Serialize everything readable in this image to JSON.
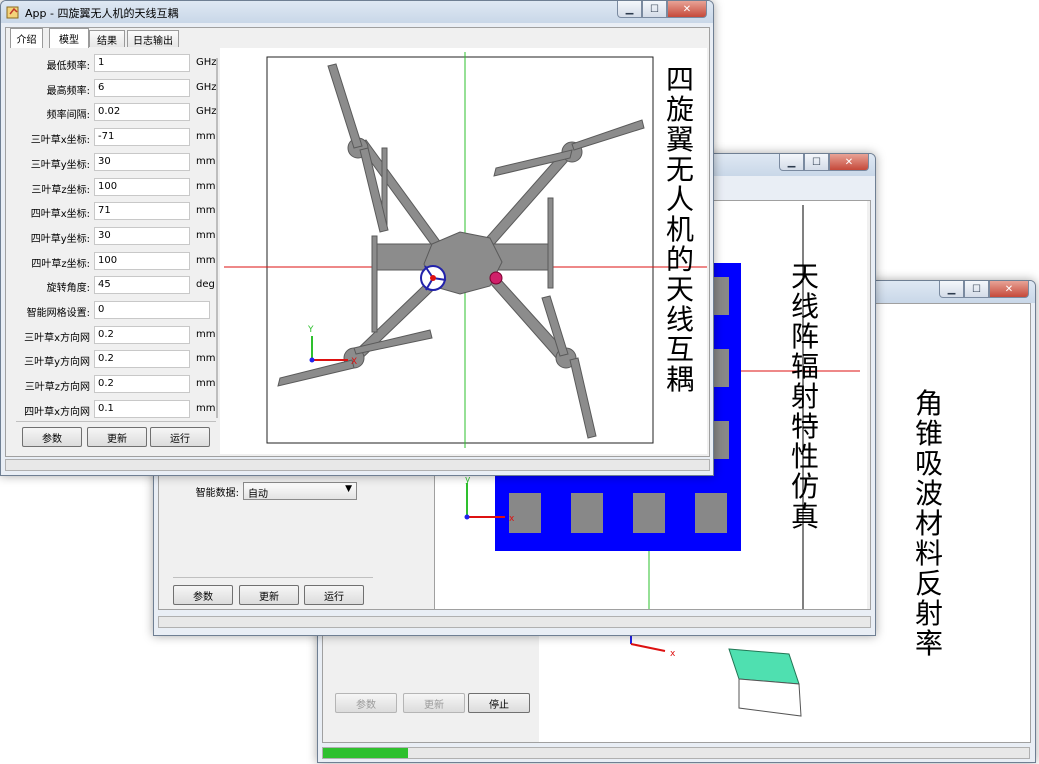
{
  "win3": {
    "buttons": {
      "params": "参数",
      "update": "更新",
      "stop": "停止"
    },
    "progress": 0.12,
    "caption": "角锥吸波材料反射率"
  },
  "win2": {
    "smart_data_label": "智能数据:",
    "smart_data_value": "自动",
    "buttons": {
      "params": "参数",
      "update": "更新",
      "run": "运行"
    },
    "caption": "天线阵辐射特性仿真"
  },
  "win1": {
    "title": "App - 四旋翼无人机的天线互耦",
    "tabs": [
      "介绍",
      "模型",
      "结果",
      "日志输出"
    ],
    "active_tab": 1,
    "params": [
      {
        "label": "最低频率:",
        "value": "1",
        "unit": "GHz"
      },
      {
        "label": "最高频率:",
        "value": "6",
        "unit": "GHz"
      },
      {
        "label": "频率间隔:",
        "value": "0.02",
        "unit": "GHz"
      },
      {
        "label": "三叶草x坐标:",
        "value": "-71",
        "unit": "mm"
      },
      {
        "label": "三叶草y坐标:",
        "value": "30",
        "unit": "mm"
      },
      {
        "label": "三叶草z坐标:",
        "value": "100",
        "unit": "mm"
      },
      {
        "label": "四叶草x坐标:",
        "value": "71",
        "unit": "mm"
      },
      {
        "label": "四叶草y坐标:",
        "value": "30",
        "unit": "mm"
      },
      {
        "label": "四叶草z坐标:",
        "value": "100",
        "unit": "mm"
      },
      {
        "label": "旋转角度:",
        "value": "45",
        "unit": "deg"
      },
      {
        "label": "智能网格设置:",
        "value": "0",
        "unit": ""
      },
      {
        "label": "三叶草x方向网",
        "value": "0.2",
        "unit": "mm"
      },
      {
        "label": "三叶草y方向网",
        "value": "0.2",
        "unit": "mm"
      },
      {
        "label": "三叶草z方向网",
        "value": "0.2",
        "unit": "mm"
      },
      {
        "label": "四叶草x方向网",
        "value": "0.1",
        "unit": "mm"
      }
    ],
    "buttons": {
      "params": "参数",
      "update": "更新",
      "run": "运行"
    },
    "caption": "四旋翼无人机的天线互耦",
    "axis_labels": {
      "y": "Y",
      "x": "X"
    }
  },
  "colors": {
    "accent_green": "#2ec02e",
    "array_blue": "#0000ff",
    "drone_gray": "#888888"
  }
}
